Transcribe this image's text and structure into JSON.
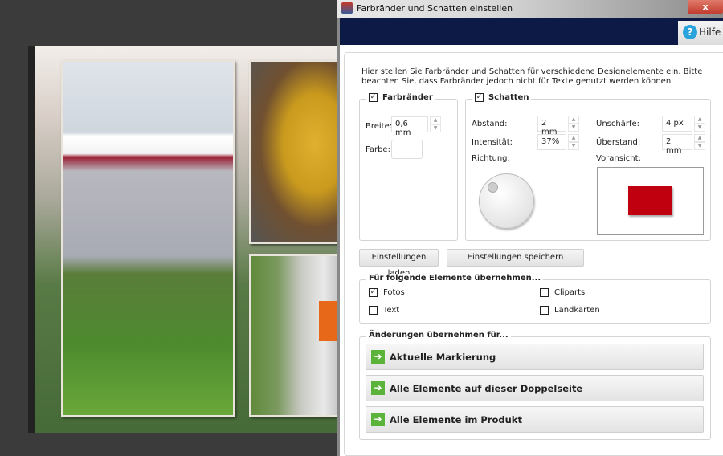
{
  "dialog": {
    "title": "Farbränder und Schatten einstellen",
    "close_label": "x",
    "help_label": "Hilfe",
    "intro": "Hier stellen Sie Farbränder und Schatten für verschiedene Designelemente ein. Bitte beachten Sie, dass Farbränder jedoch nicht für Texte genutzt werden können.",
    "borders": {
      "title": "Farbränder",
      "checked": true,
      "width_label": "Breite:",
      "width_value": "0,6 mm",
      "color_label": "Farbe:"
    },
    "shadow": {
      "title": "Schatten",
      "checked": true,
      "distance_label": "Abstand:",
      "distance_value": "2 mm",
      "intensity_label": "Intensität:",
      "intensity_value": "37%",
      "blur_label": "Unschärfe:",
      "blur_value": "4 px",
      "overhang_label": "Überstand:",
      "overhang_value": "2 mm",
      "direction_label": "Richtung:",
      "preview_label": "Voransicht:"
    },
    "load_button": "Einstellungen laden",
    "save_button": "Einstellungen speichern",
    "elements": {
      "title": "Für folgende Elemente übernehmen...",
      "items": [
        {
          "label": "Fotos",
          "checked": true
        },
        {
          "label": "Cliparts",
          "checked": false
        },
        {
          "label": "Text",
          "checked": false
        },
        {
          "label": "Landkarten",
          "checked": false
        }
      ]
    },
    "apply": {
      "title": "Änderungen übernehmen für...",
      "buttons": [
        "Aktuelle Markierung",
        "Alle Elemente auf dieser Doppelseite",
        "Alle Elemente im Produkt"
      ]
    },
    "colors": {
      "preview_fill": "#c0000e",
      "arrow": "#5bb33a",
      "header": "#0c1a45"
    }
  }
}
